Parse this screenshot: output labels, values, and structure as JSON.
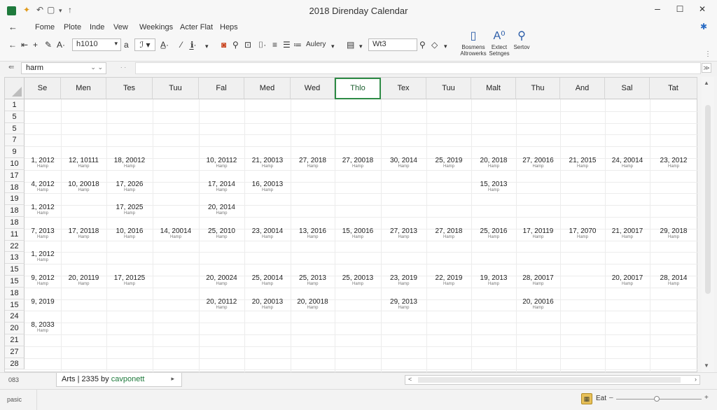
{
  "window": {
    "title": "2018 Direnday Calendar",
    "minimize": "–",
    "maximize": "☐",
    "close": "✕"
  },
  "menu": {
    "back": "←",
    "items": [
      "Fome",
      "Plote",
      "Inde",
      "Vew",
      "Weekings",
      "Acter Flat",
      "Heps"
    ],
    "assist": "✱"
  },
  "toolbar": {
    "font_size": "h1010",
    "dropdown": "▾",
    "letter_a": "a",
    "icon_label": "Aulery",
    "style_box": "Wt3",
    "big_buttons": [
      {
        "label1": "Bosmens",
        "label2": "Altrowerks",
        "icon": "page-icon"
      },
      {
        "label1": "Extect",
        "label2": "Setnges",
        "icon": "format-icon"
      },
      {
        "label1": "Sertov",
        "label2": "",
        "icon": "search-icon"
      }
    ]
  },
  "formula": {
    "name_box": "harm",
    "name_dd": "⌄ ⌄",
    "fx": "· ·",
    "toggle": "≫"
  },
  "sheet": {
    "selected_column": 7,
    "columns": [
      "Se",
      "Men",
      "Tes",
      "Tuu",
      "Fal",
      "Med",
      "Wed",
      "Thlo",
      "Tex",
      "Tuu",
      "Malt",
      "Thu",
      "And",
      "Sal",
      "Tat"
    ],
    "row_numbers": [
      "1",
      "5",
      "5",
      "7",
      "9",
      "10",
      "17",
      "18",
      "19",
      "18",
      "18",
      "11",
      "22",
      "13",
      "15",
      "15",
      "18",
      "15",
      "24",
      "20",
      "21",
      "27",
      "28"
    ],
    "cells": [
      {
        "r": 5,
        "c": 0,
        "d": "1, 2012",
        "s": "Hamp"
      },
      {
        "r": 5,
        "c": 1,
        "d": "12, 10111",
        "s": "Hamp"
      },
      {
        "r": 5,
        "c": 2,
        "d": "18, 20012",
        "s": "Hamp"
      },
      {
        "r": 5,
        "c": 4,
        "d": "10, 20112",
        "s": "Hamp"
      },
      {
        "r": 5,
        "c": 5,
        "d": "21, 20013",
        "s": "Hamp"
      },
      {
        "r": 5,
        "c": 6,
        "d": "27, 2018",
        "s": "Hamp"
      },
      {
        "r": 5,
        "c": 7,
        "d": "27, 20018",
        "s": "Hamp"
      },
      {
        "r": 5,
        "c": 8,
        "d": "30, 2014",
        "s": "Hamp"
      },
      {
        "r": 5,
        "c": 9,
        "d": "25, 2019",
        "s": "Hamp"
      },
      {
        "r": 5,
        "c": 10,
        "d": "20, 2018",
        "s": "Hamp"
      },
      {
        "r": 5,
        "c": 11,
        "d": "27, 20016",
        "s": "Hamp"
      },
      {
        "r": 5,
        "c": 12,
        "d": "21, 2015",
        "s": "Hamp"
      },
      {
        "r": 5,
        "c": 13,
        "d": "24, 20014",
        "s": "Hamp"
      },
      {
        "r": 5,
        "c": 14,
        "d": "23, 2012",
        "s": "Hamp"
      },
      {
        "r": 7,
        "c": 0,
        "d": "4, 2012",
        "s": "Hamp"
      },
      {
        "r": 7,
        "c": 1,
        "d": "10, 20018",
        "s": "Hamp"
      },
      {
        "r": 7,
        "c": 2,
        "d": "17, 2026",
        "s": "Hamp"
      },
      {
        "r": 7,
        "c": 4,
        "d": "17, 2014",
        "s": "Hamp"
      },
      {
        "r": 7,
        "c": 5,
        "d": "16, 20013",
        "s": "Hamp"
      },
      {
        "r": 7,
        "c": 10,
        "d": "15, 2013",
        "s": "Hamp"
      },
      {
        "r": 9,
        "c": 0,
        "d": "1, 2012",
        "s": "Hamp"
      },
      {
        "r": 9,
        "c": 2,
        "d": "17, 2025",
        "s": "Hamp"
      },
      {
        "r": 9,
        "c": 4,
        "d": "20, 2014",
        "s": "Hamp"
      },
      {
        "r": 11,
        "c": 0,
        "d": "7, 2013",
        "s": "Hamp"
      },
      {
        "r": 11,
        "c": 1,
        "d": "17, 20118",
        "s": "Hamp"
      },
      {
        "r": 11,
        "c": 2,
        "d": "10, 2016",
        "s": "Hamp"
      },
      {
        "r": 11,
        "c": 3,
        "d": "14, 20014",
        "s": "Hamp"
      },
      {
        "r": 11,
        "c": 4,
        "d": "25, 2010",
        "s": "Hamp"
      },
      {
        "r": 11,
        "c": 5,
        "d": "23, 20014",
        "s": "Hamp"
      },
      {
        "r": 11,
        "c": 6,
        "d": "13, 2016",
        "s": "Hamp"
      },
      {
        "r": 11,
        "c": 7,
        "d": "15, 20016",
        "s": "Hamp"
      },
      {
        "r": 11,
        "c": 8,
        "d": "27, 2013",
        "s": "Hamp"
      },
      {
        "r": 11,
        "c": 9,
        "d": "27, 2018",
        "s": "Hamp"
      },
      {
        "r": 11,
        "c": 10,
        "d": "25, 2016",
        "s": "Hamp"
      },
      {
        "r": 11,
        "c": 11,
        "d": "17, 20119",
        "s": "Hamp"
      },
      {
        "r": 11,
        "c": 12,
        "d": "17, 2070",
        "s": "Hamp"
      },
      {
        "r": 11,
        "c": 13,
        "d": "21, 20017",
        "s": "Hamp"
      },
      {
        "r": 11,
        "c": 14,
        "d": "29, 2018",
        "s": "Hamp"
      },
      {
        "r": 13,
        "c": 0,
        "d": "1, 2012",
        "s": "Hamp"
      },
      {
        "r": 15,
        "c": 0,
        "d": "9, 2012",
        "s": "Hamp"
      },
      {
        "r": 15,
        "c": 1,
        "d": "20, 20119",
        "s": "Hamp"
      },
      {
        "r": 15,
        "c": 2,
        "d": "17, 20125",
        "s": "Hamp"
      },
      {
        "r": 15,
        "c": 4,
        "d": "20, 20024",
        "s": "Hamp"
      },
      {
        "r": 15,
        "c": 5,
        "d": "25, 20014",
        "s": "Hamp"
      },
      {
        "r": 15,
        "c": 6,
        "d": "25, 2013",
        "s": "Hamp"
      },
      {
        "r": 15,
        "c": 7,
        "d": "25, 20013",
        "s": "Hamp"
      },
      {
        "r": 15,
        "c": 8,
        "d": "23, 2019",
        "s": "Hamp"
      },
      {
        "r": 15,
        "c": 9,
        "d": "22, 2019",
        "s": "Hamp"
      },
      {
        "r": 15,
        "c": 10,
        "d": "19, 2013",
        "s": "Hamp"
      },
      {
        "r": 15,
        "c": 11,
        "d": "28, 20017",
        "s": "Hamp"
      },
      {
        "r": 15,
        "c": 13,
        "d": "20, 20017",
        "s": "Hamp"
      },
      {
        "r": 15,
        "c": 14,
        "d": "28, 2014",
        "s": "Hamp"
      },
      {
        "r": 17,
        "c": 0,
        "d": "9, 2019",
        "s": ""
      },
      {
        "r": 17,
        "c": 4,
        "d": "20, 20112",
        "s": "Hamp"
      },
      {
        "r": 17,
        "c": 5,
        "d": "20, 20013",
        "s": "Hamp"
      },
      {
        "r": 17,
        "c": 6,
        "d": "20, 20018",
        "s": "Hamp"
      },
      {
        "r": 17,
        "c": 8,
        "d": "29, 2013",
        "s": "Hamp"
      },
      {
        "r": 17,
        "c": 11,
        "d": "20, 20016",
        "s": "Hamp"
      },
      {
        "r": 19,
        "c": 0,
        "d": "8, 2033",
        "s": "Hamp"
      }
    ]
  },
  "sheetbar": {
    "row_count": "083",
    "tab_label": "Arts | 2335 by",
    "tab_sub": "cavponett",
    "next": "▸",
    "scroll_left": "<",
    "scroll_right": "›"
  },
  "status": {
    "state": "pasic",
    "view_label": "Eat",
    "zoom_minus": "–",
    "zoom_plus": "+"
  }
}
